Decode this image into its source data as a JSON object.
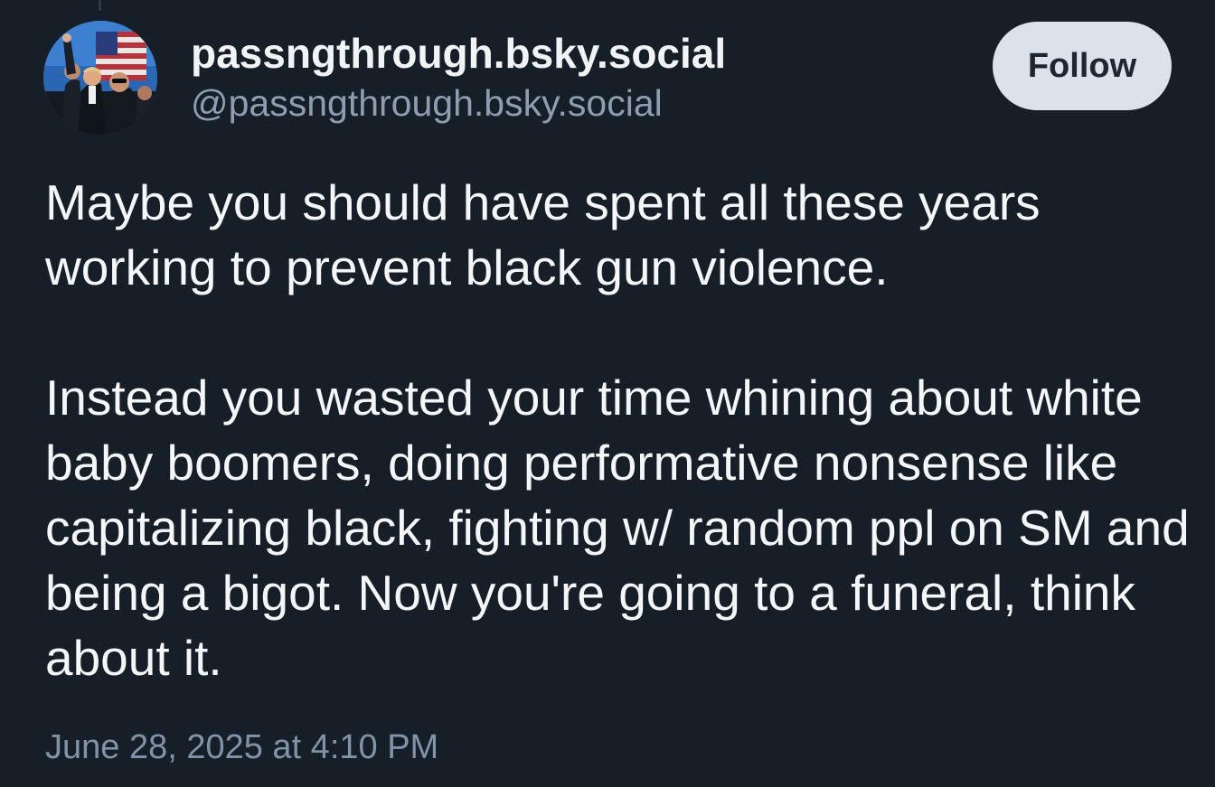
{
  "author": {
    "display_name": "passngthrough.bsky.social",
    "handle": "@passngthrough.bsky.social"
  },
  "follow_button": {
    "label": "Follow"
  },
  "post": {
    "paragraphs": [
      "Maybe you should have spent all these years working to prevent black gun violence.",
      "Instead you wasted your time whining about white baby boomers, doing performative nonsense like capitalizing black, fighting w/ random ppl on SM and being a bigot. Now you're going to a funeral, think about it."
    ],
    "timestamp": "June 28, 2025 at 4:10 PM"
  },
  "colors": {
    "background": "#161e27",
    "display_name": "#f1f3f5",
    "handle": "#8d9eb2",
    "follow_button_bg": "#dce2ea",
    "follow_button_text": "#1c2733",
    "body_text": "#f4f6f8",
    "timestamp": "#8193a8"
  }
}
